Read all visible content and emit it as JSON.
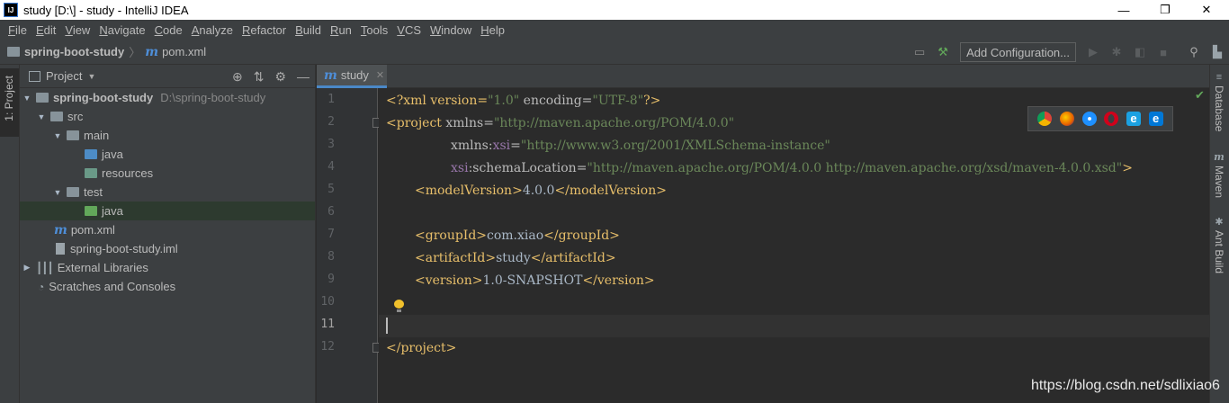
{
  "window": {
    "app_icon": "IJ",
    "title": "study [D:\\] - study - IntelliJ IDEA",
    "minimize": "—",
    "maximize": "❐",
    "close": "✕"
  },
  "menu": [
    "File",
    "Edit",
    "View",
    "Navigate",
    "Code",
    "Analyze",
    "Refactor",
    "Build",
    "Run",
    "Tools",
    "VCS",
    "Window",
    "Help"
  ],
  "breadcrumb": {
    "project": "spring-boot-study",
    "file_icon": "m",
    "file": "pom.xml"
  },
  "toolbar": {
    "add_configuration": "Add Configuration...",
    "icons": [
      "build-project-icon",
      "hammer-icon",
      "run-icon",
      "debug-icon",
      "coverage-icon",
      "stop-icon",
      "search-icon",
      "project-structure-icon"
    ]
  },
  "left_stripe": {
    "project_tab": "1: Project"
  },
  "project_panel": {
    "title": "Project",
    "tree": [
      {
        "name": "spring-boot-study",
        "path": "D:\\spring-boot-study",
        "level": 0,
        "expanded": true,
        "icon": "module-folder-icon"
      },
      {
        "name": "src",
        "level": 1,
        "expanded": true,
        "icon": "folder-icon"
      },
      {
        "name": "main",
        "level": 2,
        "expanded": true,
        "icon": "folder-icon"
      },
      {
        "name": "java",
        "level": 3,
        "icon": "source-folder-icon"
      },
      {
        "name": "resources",
        "level": 3,
        "icon": "resources-folder-icon"
      },
      {
        "name": "test",
        "level": 2,
        "expanded": true,
        "icon": "folder-icon"
      },
      {
        "name": "java",
        "level": 3,
        "icon": "test-folder-icon",
        "selected": true
      },
      {
        "name": "pom.xml",
        "level": 1,
        "icon": "maven-icon"
      },
      {
        "name": "spring-boot-study.iml",
        "level": 1,
        "icon": "iml-file-icon"
      },
      {
        "name": "External Libraries",
        "level": 0,
        "expanded": false,
        "icon": "libraries-icon"
      },
      {
        "name": "Scratches and Consoles",
        "level": 0,
        "icon": "scratches-icon"
      }
    ]
  },
  "editor": {
    "tab_icon": "m",
    "tab_label": "study",
    "line_numbers": [
      "1",
      "2",
      "3",
      "4",
      "5",
      "6",
      "7",
      "8",
      "9",
      "10",
      "11",
      "12"
    ],
    "current_line": 11,
    "lines": {
      "l1": [
        "<?xml version=",
        "\"1.0\"",
        " encoding=",
        "\"UTF-8\"",
        "?>"
      ],
      "l2": [
        "<project",
        " xmlns=",
        "\"http://maven.apache.org/POM/4.0.0\""
      ],
      "l3": [
        "xmlns:",
        "xsi",
        "=",
        "\"http://www.w3.org/2001/XMLSchema-instance\""
      ],
      "l4": [
        "xsi",
        ":schemaLocation=",
        "\"http://maven.apache.org/POM/4.0.0 http://maven.apache.org/xsd/maven-4.0.0.xsd\"",
        ">"
      ],
      "l5": [
        "<modelVersion>",
        "4.0.0",
        "</modelVersion>"
      ],
      "l7": [
        "<groupId>",
        "com.xiao",
        "</groupId>"
      ],
      "l8": [
        "<artifactId>",
        "study",
        "</artifactId>"
      ],
      "l9": [
        "<version>",
        "1.0-SNAPSHOT",
        "</version>"
      ],
      "l12": [
        "</project>"
      ]
    }
  },
  "browsers": [
    "chrome-icon",
    "firefox-icon",
    "safari-icon",
    "opera-icon",
    "ie-icon",
    "edge-icon"
  ],
  "right_stripe": {
    "database": "Database",
    "maven": "Maven",
    "ant": "Ant Build"
  },
  "watermark": "https://blog.csdn.net/sdlixiao6",
  "colors": {
    "tag": "#e8bf6a",
    "value": "#6a8759",
    "namespace": "#9876aa",
    "accent": "#4a88c7"
  }
}
